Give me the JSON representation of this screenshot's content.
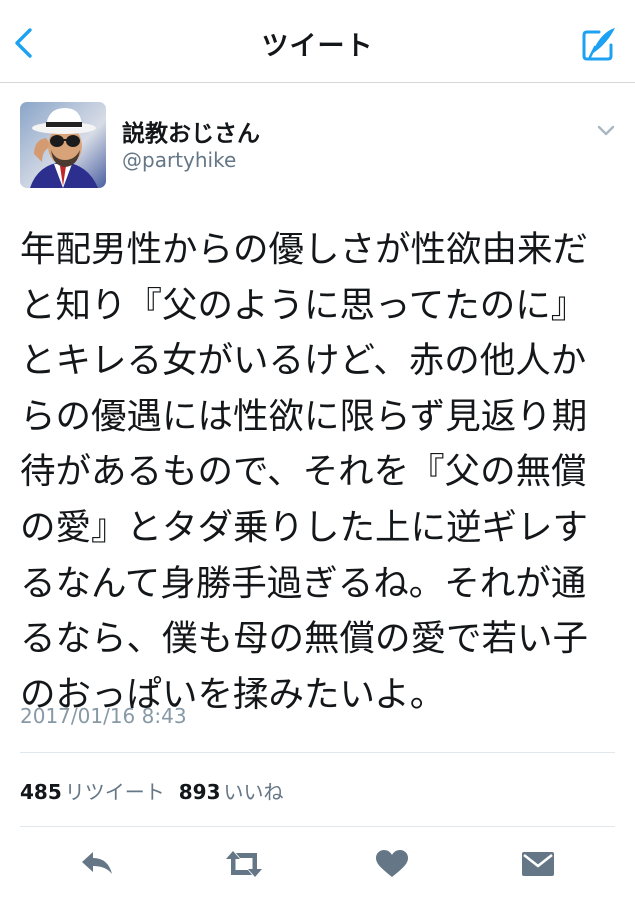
{
  "nav": {
    "title": "ツイート",
    "back_icon": "chevron-left-icon",
    "compose_icon": "compose-tweet-icon",
    "accent_color": "#1da1f2"
  },
  "author": {
    "display_name": "説教おじさん",
    "handle": "@partyhike",
    "avatar": "avatar-man-with-white-hat-and-sunglasses"
  },
  "tweet": {
    "lines": [
      "年配男性からの優しさが性欲由来だ",
      "と知り『父のように思ってたのに』",
      "とキレる女がいるけど、赤の他人か",
      "らの優遇には性欲に限らず見返り期",
      "待があるもので、それを『父の無償",
      "の愛』とタダ乗りした上に逆ギレす",
      "るなんて身勝手過ぎるね。それが通",
      "るなら、僕も母の無償の愛で若い子",
      "のおっぱいを揉みたいよ。"
    ],
    "timestamp": "2017/01/16 8:43"
  },
  "stats": {
    "retweet_count": "485",
    "retweet_label": "リツイート",
    "like_count": "893",
    "like_label": "いいね"
  },
  "actions": [
    {
      "name": "reply-icon"
    },
    {
      "name": "retweet-icon"
    },
    {
      "name": "like-heart-icon"
    },
    {
      "name": "direct-message-icon"
    }
  ],
  "colors": {
    "text": "#14171a",
    "secondary": "#657786",
    "icon_gray": "#657786",
    "divider": "#e1e8ed"
  }
}
